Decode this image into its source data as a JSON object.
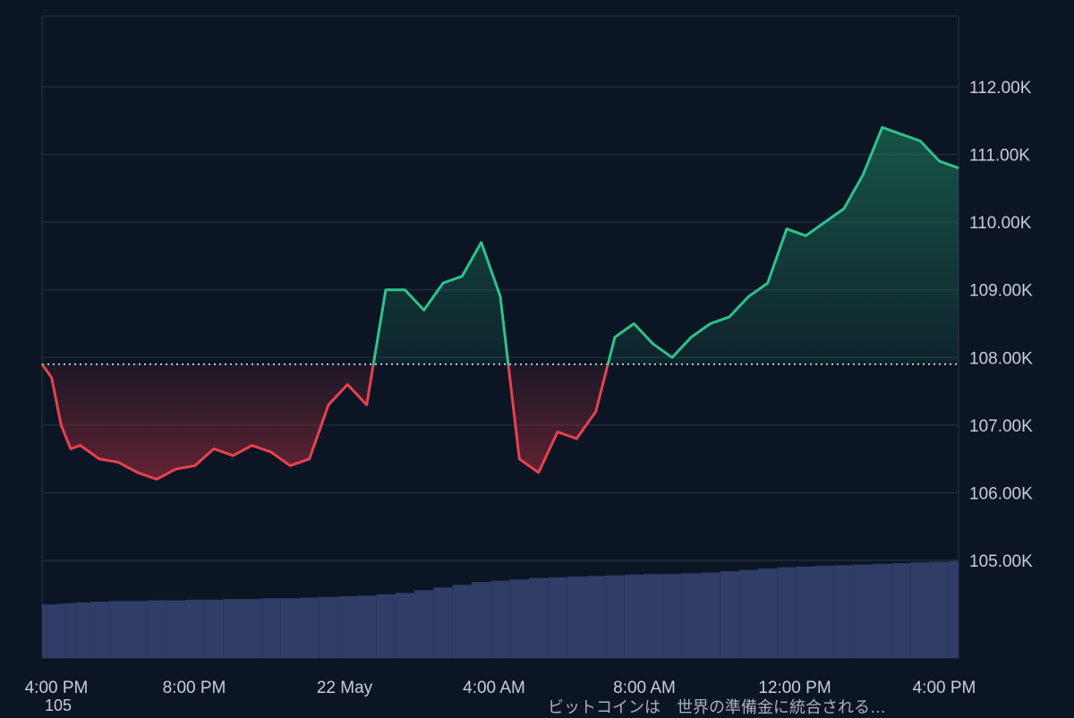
{
  "chart_data": {
    "type": "area",
    "title": "",
    "xlabel": "",
    "ylabel": "",
    "baseline": 107900,
    "ylim": [
      104100,
      113000
    ],
    "y_ticks": [
      105000,
      106000,
      107000,
      108000,
      109000,
      110000,
      111000,
      112000
    ],
    "y_tick_labels": [
      "105.00K",
      "106.00K",
      "107.00K",
      "108.00K",
      "109.00K",
      "110.00K",
      "111.00K",
      "112.00K"
    ],
    "x_range": [
      0,
      24
    ],
    "x_ticks": [
      0,
      4,
      8,
      12,
      16,
      20,
      24
    ],
    "x_tick_labels": [
      "4:00 PM",
      "8:00 PM",
      "22 May",
      "4:00 AM",
      "8:00 AM",
      "12:00 PM",
      "4:00 PM"
    ],
    "series": [
      {
        "x": [
          0,
          0.25,
          0.5,
          0.75,
          1.0,
          1.5,
          2.0,
          2.5,
          3.0,
          3.5,
          4.0,
          4.5,
          5.0,
          5.5,
          6.0,
          6.5,
          7.0,
          7.5,
          8.0,
          8.5,
          9.0,
          9.5,
          10.0,
          10.5,
          11.0,
          11.5,
          12.0,
          12.5,
          13.0,
          13.5,
          14.0,
          14.5,
          15.0,
          15.5,
          16.0,
          16.5,
          17.0,
          17.5,
          18.0,
          18.5,
          19.0,
          19.5,
          20.0,
          20.5,
          21.0,
          21.5,
          22.0,
          22.5,
          23.0,
          23.5,
          24.0
        ],
        "values": [
          107900,
          107700,
          107000,
          106650,
          106700,
          106500,
          106450,
          106300,
          106200,
          106350,
          106400,
          106650,
          106550,
          106700,
          106600,
          106400,
          106500,
          107300,
          107600,
          107300,
          109000,
          109000,
          108700,
          109100,
          109200,
          109700,
          108900,
          106500,
          106300,
          106900,
          106800,
          107200,
          108300,
          108500,
          108200,
          108000,
          108300,
          108500,
          108600,
          108900,
          109100,
          109900,
          109800,
          110000,
          110200,
          110700,
          111400,
          111300,
          111200,
          110900,
          110800
        ]
      }
    ],
    "volume": [
      104350,
      104350,
      104360,
      104370,
      104380,
      104390,
      104400,
      104400,
      104410,
      104410,
      104420,
      104420,
      104430,
      104430,
      104440,
      104440,
      104450,
      104460,
      104470,
      104480,
      104500,
      104520,
      104560,
      104600,
      104640,
      104680,
      104700,
      104720,
      104740,
      104750,
      104760,
      104770,
      104780,
      104790,
      104800,
      104800,
      104810,
      104820,
      104840,
      104860,
      104880,
      104900,
      104910,
      104920,
      104930,
      104940,
      104950,
      104960,
      104970,
      104980,
      104990
    ],
    "colors": {
      "up": "#2ec28b",
      "down": "#e8414f",
      "volume": "#2f3d67",
      "grid": "#2a3444",
      "baseline": "#dfe3ea",
      "background": "#0c1524"
    }
  },
  "footer": {
    "left_text": "105",
    "right_text": "ビットコインは　世界の準備金に統合される…"
  }
}
